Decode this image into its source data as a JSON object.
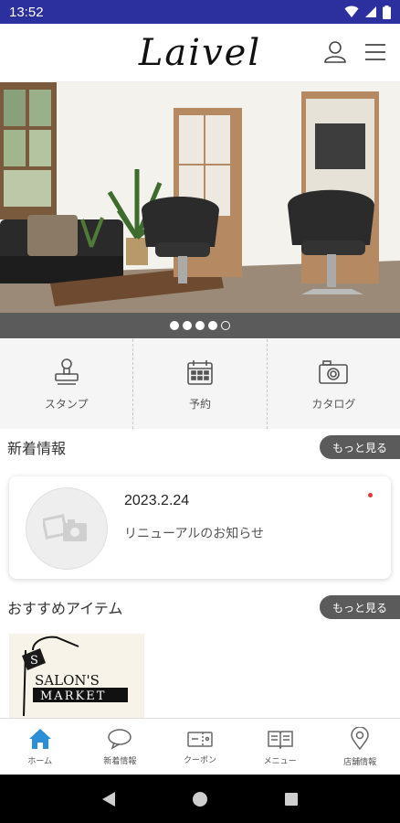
{
  "status_bar": {
    "time": "13:52"
  },
  "header": {
    "logo": "Laivel"
  },
  "carousel": {
    "total_slides": 5,
    "active_slide": 4
  },
  "quick_menu": [
    {
      "label": "スタンプ",
      "icon": "stamp-icon"
    },
    {
      "label": "予約",
      "icon": "calendar-icon"
    },
    {
      "label": "カタログ",
      "icon": "camera-icon"
    }
  ],
  "news": {
    "title": "新着情報",
    "more_label": "もっと見る",
    "items": [
      {
        "date": "2023.2.24",
        "text": "リニューアルのお知らせ",
        "unread": true
      }
    ]
  },
  "recommended": {
    "title": "おすすめアイテム",
    "more_label": "もっと見る",
    "items": [
      {
        "logo_text_1": "SALON'S",
        "logo_text_2": "MARKET",
        "logo_letter": "S"
      }
    ]
  },
  "bottom_nav": [
    {
      "label": "ホーム",
      "icon": "home-icon",
      "active": true
    },
    {
      "label": "新着情報",
      "icon": "chat-bubble-icon",
      "active": false
    },
    {
      "label": "クーポン",
      "icon": "coupon-icon",
      "active": false
    },
    {
      "label": "メニュー",
      "icon": "book-icon",
      "active": false
    },
    {
      "label": "店舗情報",
      "icon": "location-pin-icon",
      "active": false
    }
  ],
  "colors": {
    "status_bar": "#2c2f9e",
    "accent_blue": "#2a8fd6",
    "button_gray": "#5b5b5b"
  }
}
